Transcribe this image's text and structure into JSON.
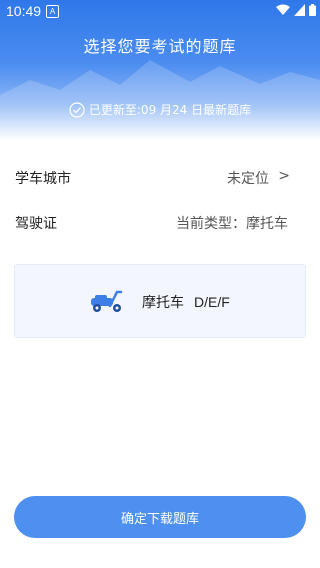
{
  "status_bar": {
    "time": "10:49",
    "a_badge": "A"
  },
  "header": {
    "title": "选择您要考试的题库",
    "update_text": "已更新至:09 月24 日最新题库"
  },
  "rows": {
    "city_label": "学车城市",
    "city_value": "未定位",
    "city_chevron": ">",
    "license_label": "驾驶证",
    "license_value": "当前类型：摩托车"
  },
  "card": {
    "name": "摩托车",
    "classes": "D/E/F"
  },
  "button": {
    "label": "确定下载题库"
  },
  "colors": {
    "primary": "#4e90ef",
    "header_top": "#2f78ea",
    "card_bg": "#f3f7fd"
  }
}
